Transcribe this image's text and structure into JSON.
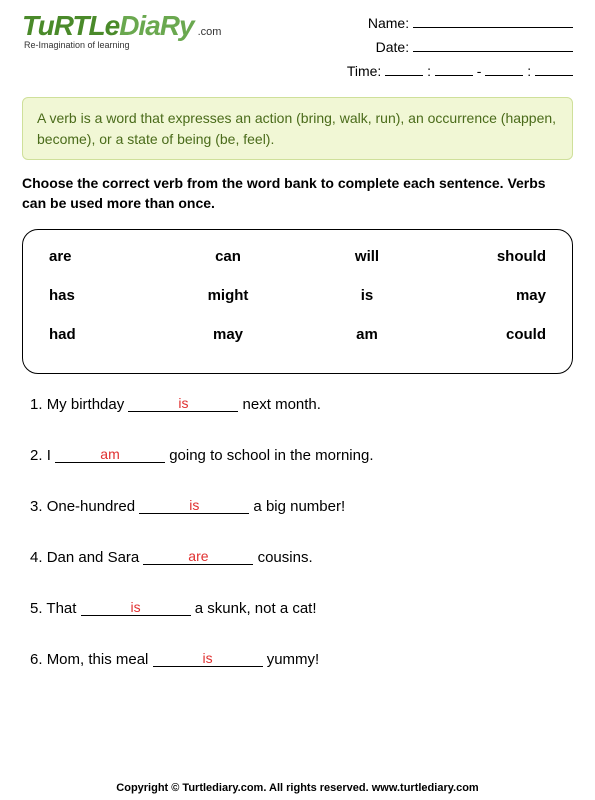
{
  "logo": {
    "brand1": "TuRTLe",
    "brand2": "DiaRy",
    "dotcom": ".com",
    "tagline": "Re-Imagination of learning"
  },
  "meta": {
    "name_label": "Name:",
    "date_label": "Date:",
    "time_label": "Time:",
    "colon": ":",
    "dash": "-"
  },
  "definition": "A verb is a word that expresses an action (bring, walk, run), an occurrence (happen, become), or a state of being (be, feel).",
  "instructions": "Choose the correct verb from the word bank to complete each sentence. Verbs can be used more than once.",
  "wordbank": [
    [
      "are",
      "can",
      "will",
      "should"
    ],
    [
      "has",
      "might",
      "is",
      "may"
    ],
    [
      "had",
      "may",
      "am",
      "could"
    ]
  ],
  "sentences": [
    {
      "num": "1.",
      "pre": "My birthday ",
      "answer": "is",
      "post": " next month."
    },
    {
      "num": "2.",
      "pre": "I ",
      "answer": "am",
      "post": " going to school in the morning."
    },
    {
      "num": "3.",
      "pre": "One-hundred ",
      "answer": "is",
      "post": " a big number!"
    },
    {
      "num": "4.",
      "pre": "Dan and Sara ",
      "answer": "are",
      "post": " cousins."
    },
    {
      "num": "5.",
      "pre": "That ",
      "answer": "is",
      "post": " a skunk, not a cat!"
    },
    {
      "num": "6.",
      "pre": "Mom, this meal ",
      "answer": "is",
      "post": " yummy!"
    }
  ],
  "footer": "Copyright © Turtlediary.com. All rights reserved. www.turtlediary.com"
}
